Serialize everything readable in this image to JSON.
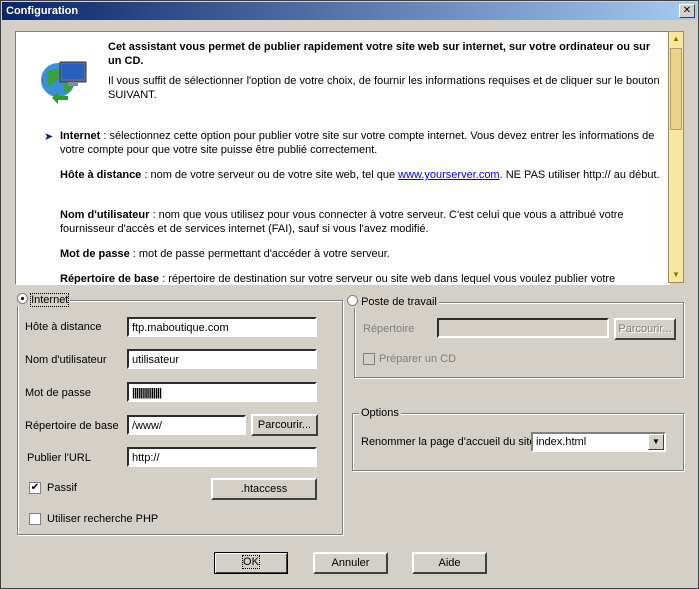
{
  "window": {
    "title": "Configuration",
    "close_label": "✕"
  },
  "info": {
    "intro_title": "Cet assistant vous permet de publier rapidement votre site web sur internet, sur votre ordinateur ou sur un CD.",
    "intro_text": "Il vous suffit de sélectionner l'option de votre choix, de fournir les informations requises et de cliquer sur le bouton SUIVANT.",
    "internet_term": "Internet",
    "internet_text": " : sélectionnez cette option pour publier votre site sur votre compte internet. Vous devez entrer les informations de votre compte pour que votre site puisse être publié correctement.",
    "host_term": "Hôte à distance",
    "host_text_a": " : nom de votre serveur ou de votre site web, tel que ",
    "host_link": "www.yourserver.com",
    "host_text_b": ". NE PAS utiliser http:// au début.",
    "user_term": "Nom d'utilisateur",
    "user_text": " : nom que vous utilisez pour vous connecter à votre serveur. C'est celui que vous a attribué votre fournisseur d'accès et de services internet (FAI), sauf si vous l'avez modifié.",
    "pwd_term": "Mot de passe",
    "pwd_text": " : mot de passe permettant d'accéder à votre serveur.",
    "dir_term": "Répertoire de base",
    "dir_text": " : répertoire de destination sur votre serveur ou site web dans lequel vous voulez publier votre"
  },
  "internet": {
    "legend": "Internet",
    "host_label": "Hôte à distance",
    "host_value": "ftp.maboutique.com",
    "user_label": "Nom d'utilisateur",
    "user_value": "utilisateur",
    "pwd_label": "Mot de passe",
    "pwd_value": "||||||||||||||",
    "basedir_label": "Répertoire de base",
    "basedir_value": "/www/",
    "browse_label": "Parcourir...",
    "url_label": "Publier l'URL",
    "url_value": "http://",
    "passive_label": "Passif",
    "passive_checked": true,
    "htaccess_label": ".htaccess",
    "php_label": "Utiliser recherche PHP",
    "php_checked": false
  },
  "workstation": {
    "legend": "Poste de travail",
    "dir_label": "Répertoire",
    "dir_value": "",
    "browse_label": "Parcourir...",
    "cd_label": "Préparer un CD",
    "cd_checked": false
  },
  "options": {
    "legend": "Options",
    "rename_label": "Renommer la page d'accueil du site",
    "rename_value": "index.html"
  },
  "buttons": {
    "ok": "OK",
    "cancel": "Annuler",
    "help": "Aide"
  }
}
